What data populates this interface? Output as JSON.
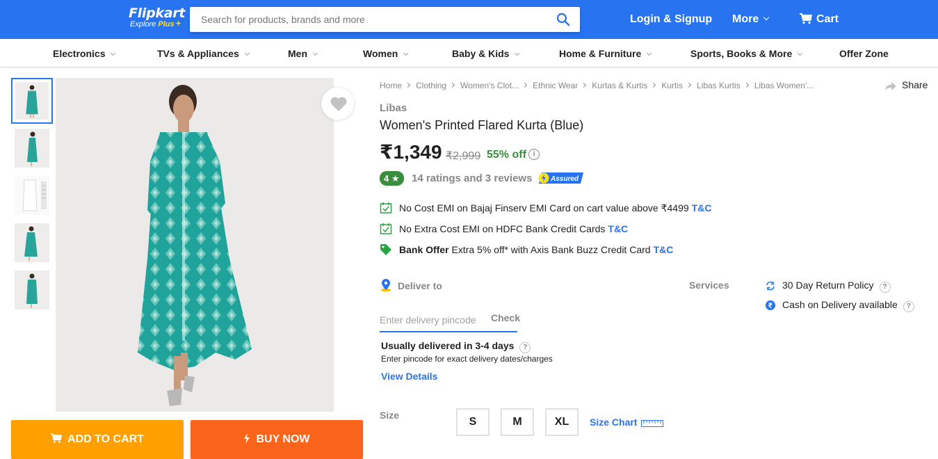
{
  "header": {
    "logo_word": "Flipkart",
    "logo_sub": "Explore",
    "logo_plus": "Plus",
    "search_placeholder": "Search for products, brands and more",
    "login": "Login & Signup",
    "more": "More",
    "cart": "Cart",
    "brand_color": "#2874f0"
  },
  "categories": [
    "Electronics",
    "TVs & Appliances",
    "Men",
    "Women",
    "Baby & Kids",
    "Home & Furniture",
    "Sports, Books & More",
    "Offer Zone"
  ],
  "breadcrumbs": [
    "Home",
    "Clothing",
    "Women's Clot...",
    "Ethnic Wear",
    "Kurtas & Kurtis",
    "Kurtis",
    "Libas Kurtis",
    "Libas Women'..."
  ],
  "share": "Share",
  "product": {
    "brand": "Libas",
    "title": "Women's Printed Flared Kurta  (Blue)",
    "price": "₹1,349",
    "mrp": "₹2,999",
    "discount": "55% off",
    "rating": "4",
    "rating_text": "14 ratings and 3 reviews",
    "assured": "Assured"
  },
  "offers": [
    {
      "bold": "",
      "text": "No Cost EMI on Bajaj Finserv EMI Card on cart value above ₹4499",
      "tc": "T&C",
      "icon": "emi-icon"
    },
    {
      "bold": "",
      "text": "No Extra Cost EMI on HDFC Bank Credit Cards",
      "tc": "T&C",
      "icon": "emi-icon"
    },
    {
      "bold": "Bank Offer",
      "text": " Extra 5% off* with Axis Bank Buzz Credit Card",
      "tc": "T&C",
      "icon": "tag-icon"
    }
  ],
  "delivery": {
    "label": "Deliver to",
    "pincode_placeholder": "Enter delivery pincode",
    "check": "Check",
    "estimate": "Usually delivered in 3-4 days",
    "note": "Enter pincode for exact delivery dates/charges",
    "view_details": "View Details"
  },
  "services": {
    "label": "Services",
    "items": [
      "30 Day Return Policy",
      "Cash on Delivery available"
    ]
  },
  "size": {
    "label": "Size",
    "options": [
      "S",
      "M",
      "XL"
    ],
    "chart": "Size Chart"
  },
  "actions": {
    "add_to_cart": "ADD TO CART",
    "buy_now": "BUY NOW"
  },
  "help_glyph": "?",
  "info_glyph": "i"
}
